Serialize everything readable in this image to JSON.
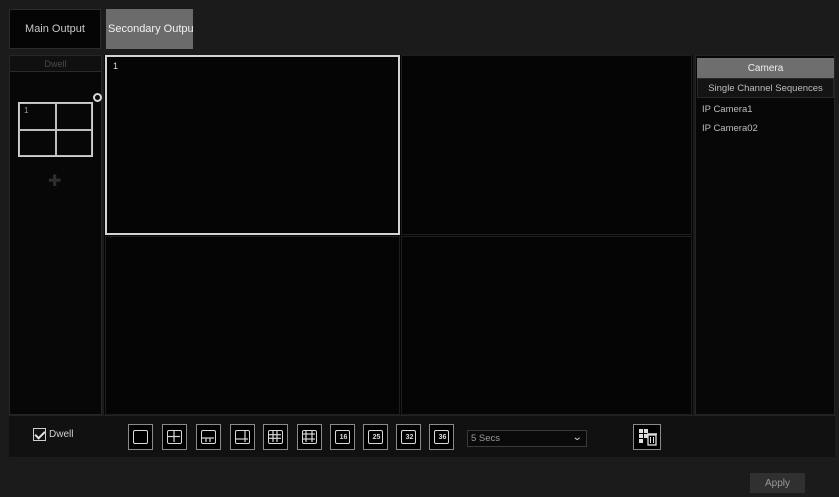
{
  "tabs": {
    "main_output": "Main Output",
    "secondary_output": "Secondary Output"
  },
  "left_panel": {
    "dwell_header": "Dwell",
    "mini_layout_cell_1": "1"
  },
  "grid": {
    "window_1_label": "1"
  },
  "right_panel": {
    "camera_tab": "Camera",
    "sequences_tab": "Single Channel Sequences",
    "cameras": [
      "IP Camera1",
      "IP Camera02"
    ]
  },
  "toolbar": {
    "dwell_label": "Dwell",
    "dwell_checked": true,
    "layout_buttons": [
      {
        "icon": "layout-1-icon"
      },
      {
        "icon": "layout-4-icon"
      },
      {
        "icon": "layout-6-icon"
      },
      {
        "icon": "layout-8-icon"
      },
      {
        "icon": "layout-9-icon"
      },
      {
        "icon": "layout-13-icon"
      },
      {
        "icon": "layout-16-icon",
        "label": "16"
      },
      {
        "icon": "layout-25-icon",
        "label": "25"
      },
      {
        "icon": "layout-32-icon",
        "label": "32"
      },
      {
        "icon": "layout-36-icon",
        "label": "36"
      }
    ],
    "dwell_time": "5 Secs"
  },
  "footer": {
    "apply_label": "Apply"
  }
}
